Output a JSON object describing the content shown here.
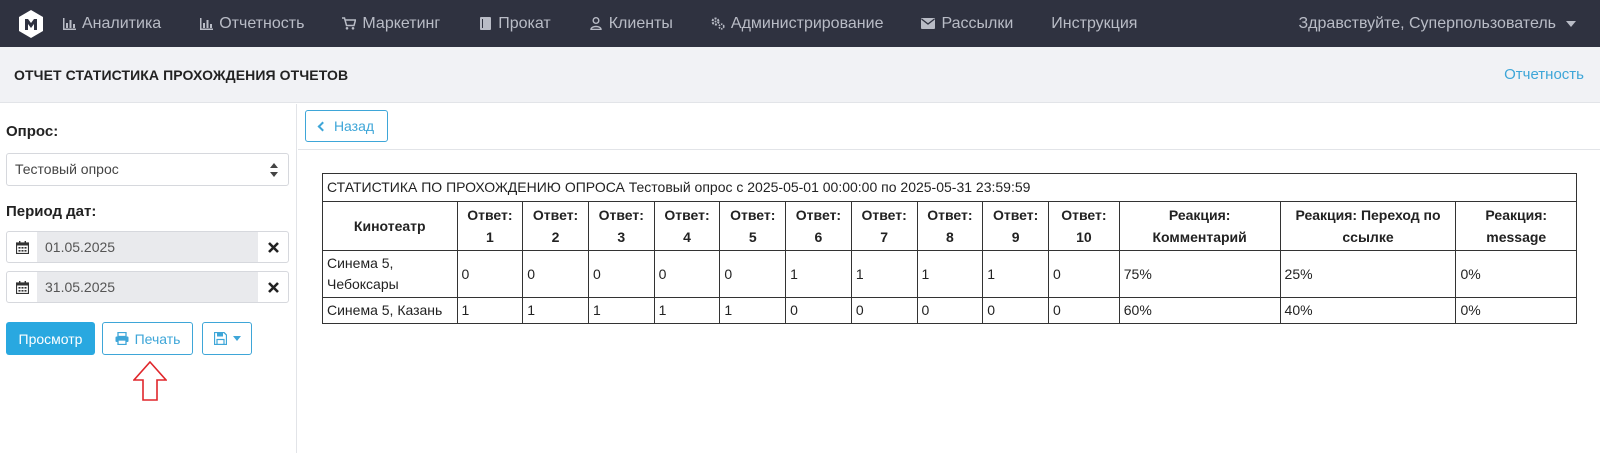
{
  "navbar": {
    "items": [
      {
        "label": "Аналитика",
        "icon": "bar-chart-icon"
      },
      {
        "label": "Отчетность",
        "icon": "bar-chart-icon"
      },
      {
        "label": "Маркетинг",
        "icon": "cart-icon"
      },
      {
        "label": "Прокат",
        "icon": "book-icon"
      },
      {
        "label": "Клиенты",
        "icon": "user-icon"
      },
      {
        "label": "Администрирование",
        "icon": "cogs-icon"
      },
      {
        "label": "Рассылки",
        "icon": "envelope-icon"
      },
      {
        "label": "Инструкция",
        "icon": ""
      }
    ],
    "user_greeting": "Здравствуйте, Суперпользователь"
  },
  "header": {
    "title": "ОТЧЕТ СТАТИСТИКА ПРОХОЖДЕНИЯ ОТЧЕТОВ",
    "breadcrumb": "Отчетность"
  },
  "sidebar": {
    "survey_label": "Опрос:",
    "survey_value": "Тестовый опрос",
    "period_label": "Период дат:",
    "date_from": "01.05.2025",
    "date_to": "31.05.2025",
    "view_button": "Просмотр",
    "print_button": "Печать"
  },
  "main": {
    "back_button": "Назад",
    "table_caption": "СТАТИСТИКА ПО ПРОХОЖДЕНИЮ ОПРОСА Тестовый опрос с 2025-05-01 00:00:00 по 2025-05-31 23:59:59",
    "columns": [
      "Кинотеатр",
      "Ответ: 1",
      "Ответ: 2",
      "Ответ: 3",
      "Ответ: 4",
      "Ответ: 5",
      "Ответ: 6",
      "Ответ: 7",
      "Ответ: 8",
      "Ответ: 9",
      "Ответ: 10",
      "Реакция: Комментарий",
      "Реакция: Переход по ссылке",
      "Реакция: message"
    ],
    "rows": [
      [
        "Синема 5, Чебоксары",
        "0",
        "0",
        "0",
        "0",
        "0",
        "1",
        "1",
        "1",
        "1",
        "0",
        "75%",
        "25%",
        "0%"
      ],
      [
        "Синема 5, Казань",
        "1",
        "1",
        "1",
        "1",
        "1",
        "0",
        "0",
        "0",
        "0",
        "0",
        "60%",
        "40%",
        "0%"
      ]
    ]
  },
  "colors": {
    "navbar_bg": "#2f3240",
    "accent": "#29a8e0",
    "annotation_arrow": "#e0262b"
  }
}
